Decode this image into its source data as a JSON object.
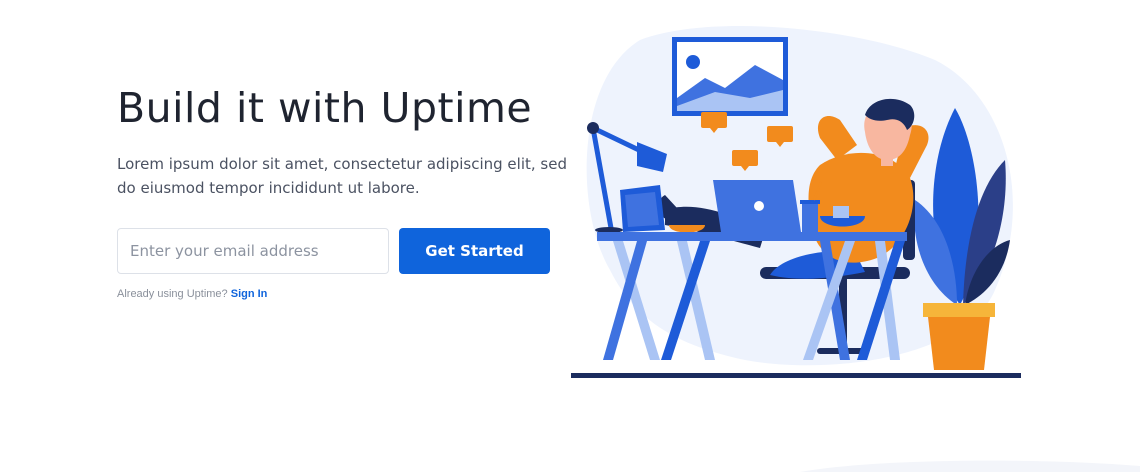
{
  "hero": {
    "headline": "Build it with Uptime",
    "subtitle": "Lorem ipsum dolor sit amet, consectetur adipiscing elit, sed do eiusmod tempor incididunt ut labore.",
    "email_placeholder": "Enter your email address",
    "cta_label": "Get Started",
    "signin_prompt": "Already using Uptime?",
    "signin_link": "Sign In"
  },
  "illustration": {
    "icon": "person-relaxing-at-desk-illustration",
    "colors": {
      "blue": "#1e5bd8",
      "light_blue": "#aac4f4",
      "orange": "#f28b1d",
      "background_blob": "#eef3fd",
      "dark_navy": "#1b2c5e"
    }
  },
  "colors": {
    "primary": "#0f64dc",
    "headline": "#1f2430",
    "body_text": "#4b5262",
    "muted_text": "#8a909b"
  }
}
